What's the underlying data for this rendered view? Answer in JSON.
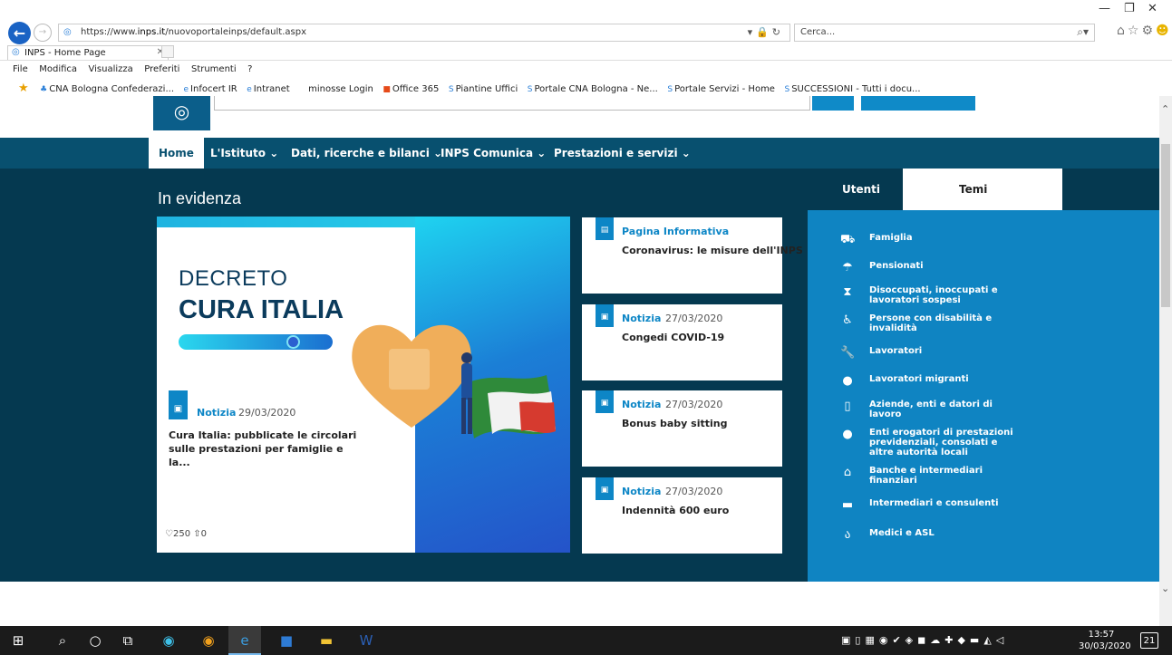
{
  "browser": {
    "url_prefix": "https://www.",
    "url_domain": "inps.it",
    "url_path": "/nuovoportaleinps/default.aspx",
    "search_placeholder": "Cerca...",
    "tab_title": "INPS - Home Page",
    "menu": [
      "File",
      "Modifica",
      "Visualizza",
      "Preferiti",
      "Strumenti",
      "?"
    ],
    "favorites": [
      {
        "icon": "star",
        "label": ""
      },
      {
        "icon": "cna",
        "label": "CNA Bologna  Confederazi..."
      },
      {
        "icon": "ie",
        "label": "Infocert IR"
      },
      {
        "icon": "ie",
        "label": "Intranet"
      },
      {
        "icon": "none",
        "label": "minosse Login"
      },
      {
        "icon": "ms",
        "label": "Office 365"
      },
      {
        "icon": "sp",
        "label": "Piantine Uffici"
      },
      {
        "icon": "sp",
        "label": "Portale CNA Bologna - Ne..."
      },
      {
        "icon": "sp",
        "label": "Portale Servizi - Home"
      },
      {
        "icon": "sp",
        "label": "SUCCESSIONI - Tutti i docu..."
      }
    ]
  },
  "nav": {
    "home": "Home",
    "istituto": "L'Istituto",
    "dati": "Dati, ricerche e bilanci",
    "comunica": "INPS Comunica",
    "prestazioni": "Prestazioni e servizi"
  },
  "main": {
    "section_title": "In evidenza",
    "hero": {
      "title_line1": "DECRETO",
      "title_line2": "CURA ITALIA",
      "card_type": "Notizia",
      "card_date": "29/03/2020",
      "card_title": "Cura Italia: pubblicate le circolari sulle prestazioni per famiglie e la...",
      "likes": "250",
      "shares": "0"
    },
    "news": [
      {
        "type": "Pagina Informativa",
        "date": "",
        "title": "Coronavirus: le misure dell'INPS"
      },
      {
        "type": "Notizia",
        "date": "27/03/2020",
        "title": "Congedi COVID-19"
      },
      {
        "type": "Notizia",
        "date": "27/03/2020",
        "title": "Bonus baby sitting"
      },
      {
        "type": "Notizia",
        "date": "27/03/2020",
        "title": "Indennità 600 euro"
      }
    ]
  },
  "side": {
    "tab_users": "Utenti",
    "tab_themes": "Temi",
    "items": [
      {
        "icon": "stroller-icon",
        "label": "Famiglia"
      },
      {
        "icon": "umbrella-icon",
        "label": "Pensionati"
      },
      {
        "icon": "hourglass-icon",
        "label": "Disoccupati, inoccupati e lavoratori sospesi"
      },
      {
        "icon": "wheelchair-icon",
        "label": "Persone con disabilità e invalidità"
      },
      {
        "icon": "wrench-icon",
        "label": "Lavoratori"
      },
      {
        "icon": "globe-icon",
        "label": "Lavoratori migranti"
      },
      {
        "icon": "building-icon",
        "label": "Aziende, enti e datori di lavoro"
      },
      {
        "icon": "piggybank-icon",
        "label": "Enti erogatori di prestazioni previdenziali, consolati e altre autorità locali"
      },
      {
        "icon": "bank-icon",
        "label": "Banche e intermediari finanziari"
      },
      {
        "icon": "briefcase-icon",
        "label": "Intermediari e consulenti"
      },
      {
        "icon": "stethoscope-icon",
        "label": "Medici e ASL"
      }
    ]
  },
  "taskbar": {
    "time": "13:57",
    "date": "30/03/2020",
    "notifications": "21"
  }
}
